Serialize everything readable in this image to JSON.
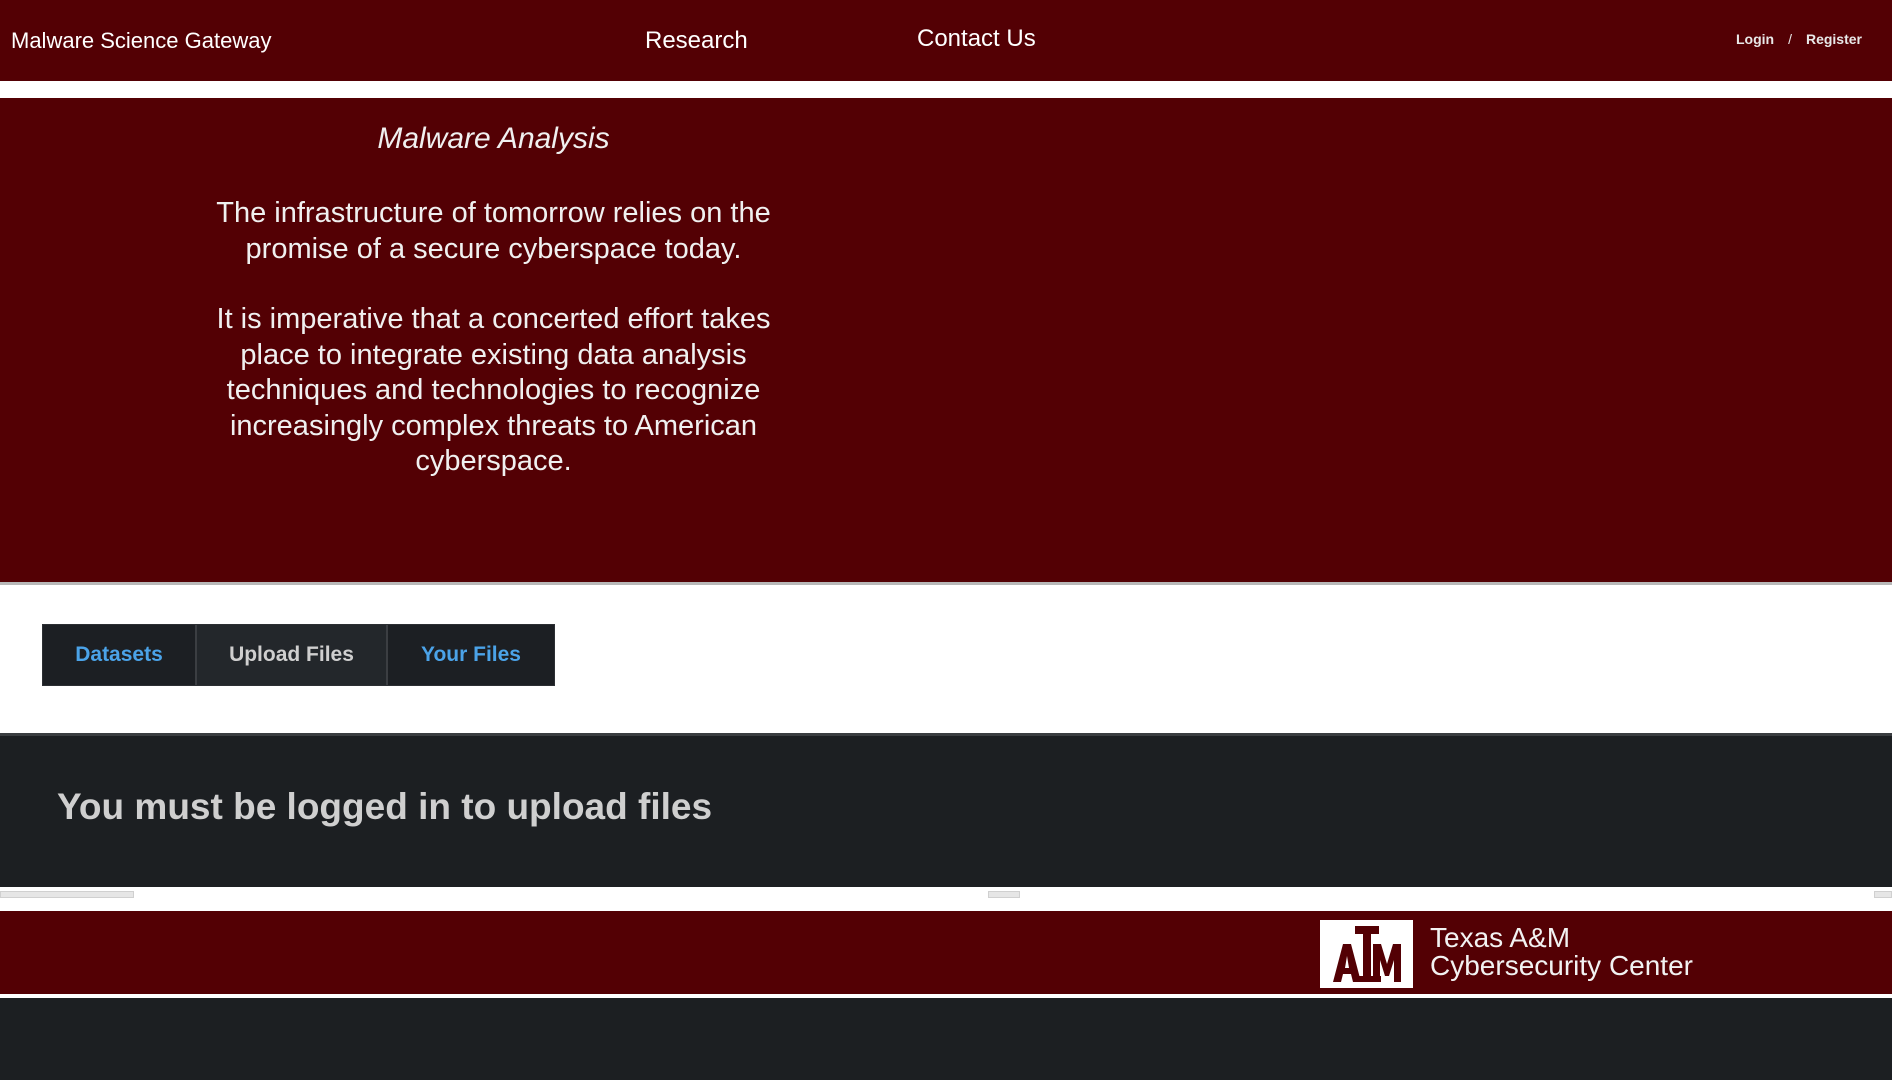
{
  "nav": {
    "brand": "Malware Science Gateway",
    "research": "Research",
    "contact": "Contact Us",
    "login": "Login",
    "separator": "/",
    "register": "Register"
  },
  "hero": {
    "title": "Malware Analysis",
    "paragraph1": "The infrastructure of tomorrow relies on the promise of a secure cyberspace today.",
    "paragraph2": "It is imperative that a concerted effort takes place to integrate existing data analysis techniques and technologies to recognize increasingly complex threats to American cyberspace."
  },
  "tabs": [
    {
      "label": "Datasets"
    },
    {
      "label": "Upload Files"
    },
    {
      "label": "Your Files"
    }
  ],
  "panel": {
    "message": "You must be logged in to upload files"
  },
  "footer": {
    "logo_line1": "Texas A&M",
    "logo_line2": "Cybersecurity Center"
  },
  "colors": {
    "maroon": "#530004",
    "dark": "#1c1f22",
    "link_blue": "#4ba3e8"
  }
}
